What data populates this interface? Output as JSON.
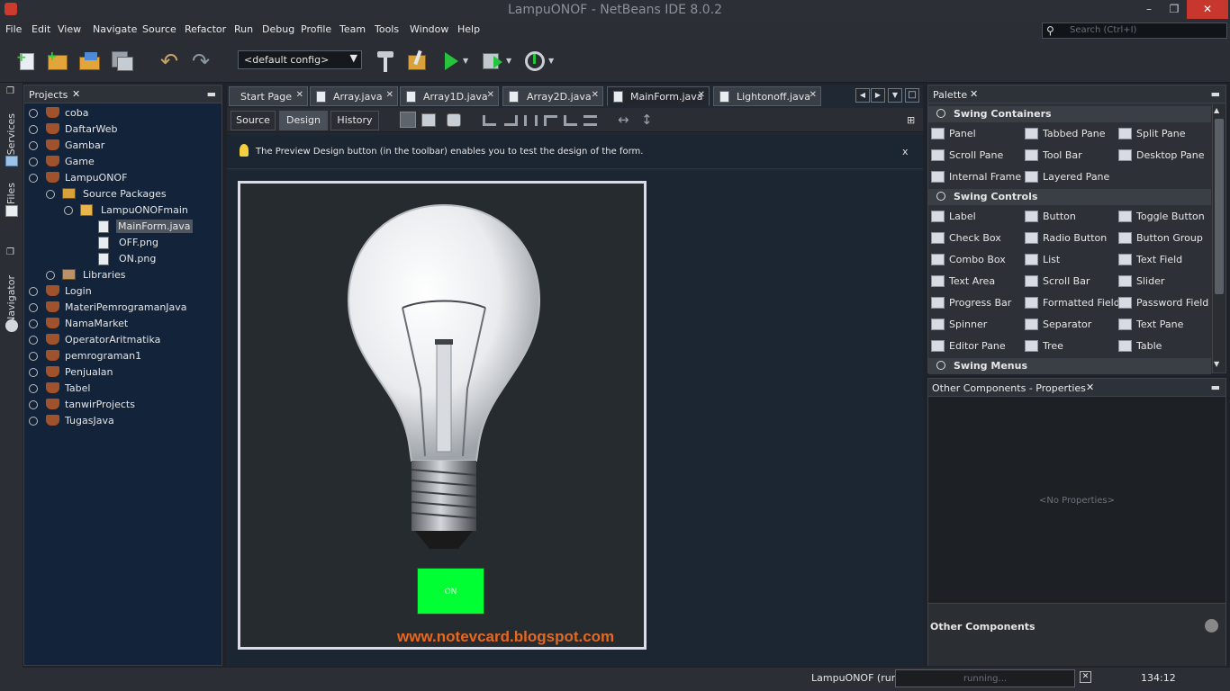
{
  "window": {
    "title": "LampuONOF - NetBeans IDE 8.0.2"
  },
  "menu": [
    "File",
    "Edit",
    "View",
    "Navigate",
    "Source",
    "Refactor",
    "Run",
    "Debug",
    "Profile",
    "Team",
    "Tools",
    "Window",
    "Help"
  ],
  "search": {
    "placeholder": "Search (Ctrl+I)"
  },
  "toolbar": {
    "config": "<default config>"
  },
  "side_strip": {
    "services": "Services",
    "files": "Files",
    "navigator": "Navigator"
  },
  "projects": {
    "title": "Projects",
    "items": [
      {
        "label": "coba"
      },
      {
        "label": "DaftarWeb"
      },
      {
        "label": "Gambar"
      },
      {
        "label": "Game"
      },
      {
        "label": "LampuONOF"
      },
      {
        "label": "Source Packages"
      },
      {
        "label": "LampuONOFmain"
      },
      {
        "label": "MainForm.java"
      },
      {
        "label": "OFF.png"
      },
      {
        "label": "ON.png"
      },
      {
        "label": "Libraries"
      },
      {
        "label": "Login"
      },
      {
        "label": "MateriPemrogramanJava"
      },
      {
        "label": "NamaMarket"
      },
      {
        "label": "OperatorAritmatika"
      },
      {
        "label": "pemrograman1"
      },
      {
        "label": "Penjualan"
      },
      {
        "label": "Tabel"
      },
      {
        "label": "tanwirProjects"
      },
      {
        "label": "TugasJava"
      }
    ]
  },
  "editor": {
    "tabs": [
      {
        "label": "Start Page"
      },
      {
        "label": "Array.java"
      },
      {
        "label": "Array1D.java"
      },
      {
        "label": "Array2D.java"
      },
      {
        "label": "MainForm.java"
      },
      {
        "label": "Lightonoff.java"
      }
    ],
    "views": {
      "source": "Source",
      "design": "Design",
      "history": "History"
    },
    "hint": "The Preview Design button (in the toolbar) enables you to test the design of the form.",
    "hint_close": "x",
    "form": {
      "button_label": "ON",
      "watermark": "www.notevcard.blogspot.com"
    }
  },
  "palette": {
    "title": "Palette",
    "categories": {
      "containers": "Swing Containers",
      "controls": "Swing Controls",
      "menus": "Swing Menus"
    },
    "containers": [
      "Panel",
      "Tabbed Pane",
      "Split Pane",
      "Scroll Pane",
      "Tool Bar",
      "Desktop Pane",
      "Internal Frame",
      "Layered Pane"
    ],
    "controls": [
      "Label",
      "Button",
      "Toggle Button",
      "Check Box",
      "Radio Button",
      "Button Group",
      "Combo Box",
      "List",
      "Text Field",
      "Text Area",
      "Scroll Bar",
      "Slider",
      "Progress Bar",
      "Formatted Field",
      "Password Field",
      "Spinner",
      "Separator",
      "Text Pane",
      "Editor Pane",
      "Tree",
      "Table"
    ]
  },
  "properties": {
    "title": "Other Components - Properties",
    "empty": "<No Properties>",
    "footer": "Other Components"
  },
  "status": {
    "task": "LampuONOF (run)",
    "progress": "running...",
    "position": "134:12"
  }
}
